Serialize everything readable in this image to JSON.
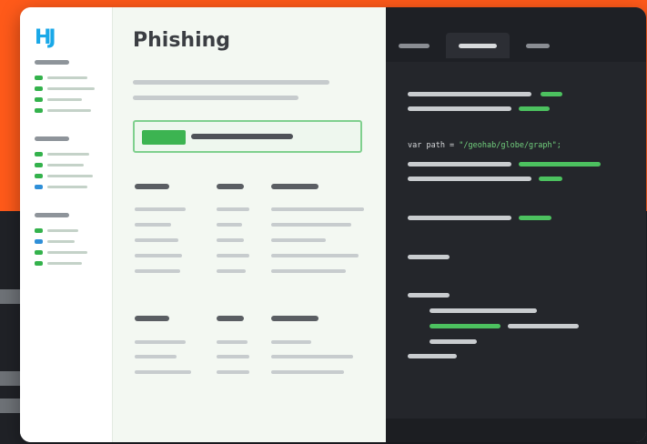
{
  "logo": {
    "text": "HJ"
  },
  "page": {
    "title": "Phishing"
  },
  "code": {
    "var_kw": "var path = ",
    "string_literal": "\"/geohab/globe/graph\";"
  },
  "colors": {
    "accent_green": "#3cb451",
    "logo_blue": "#19a8e8",
    "background_orange": "#ff5a1a",
    "code_background": "#24262b"
  }
}
